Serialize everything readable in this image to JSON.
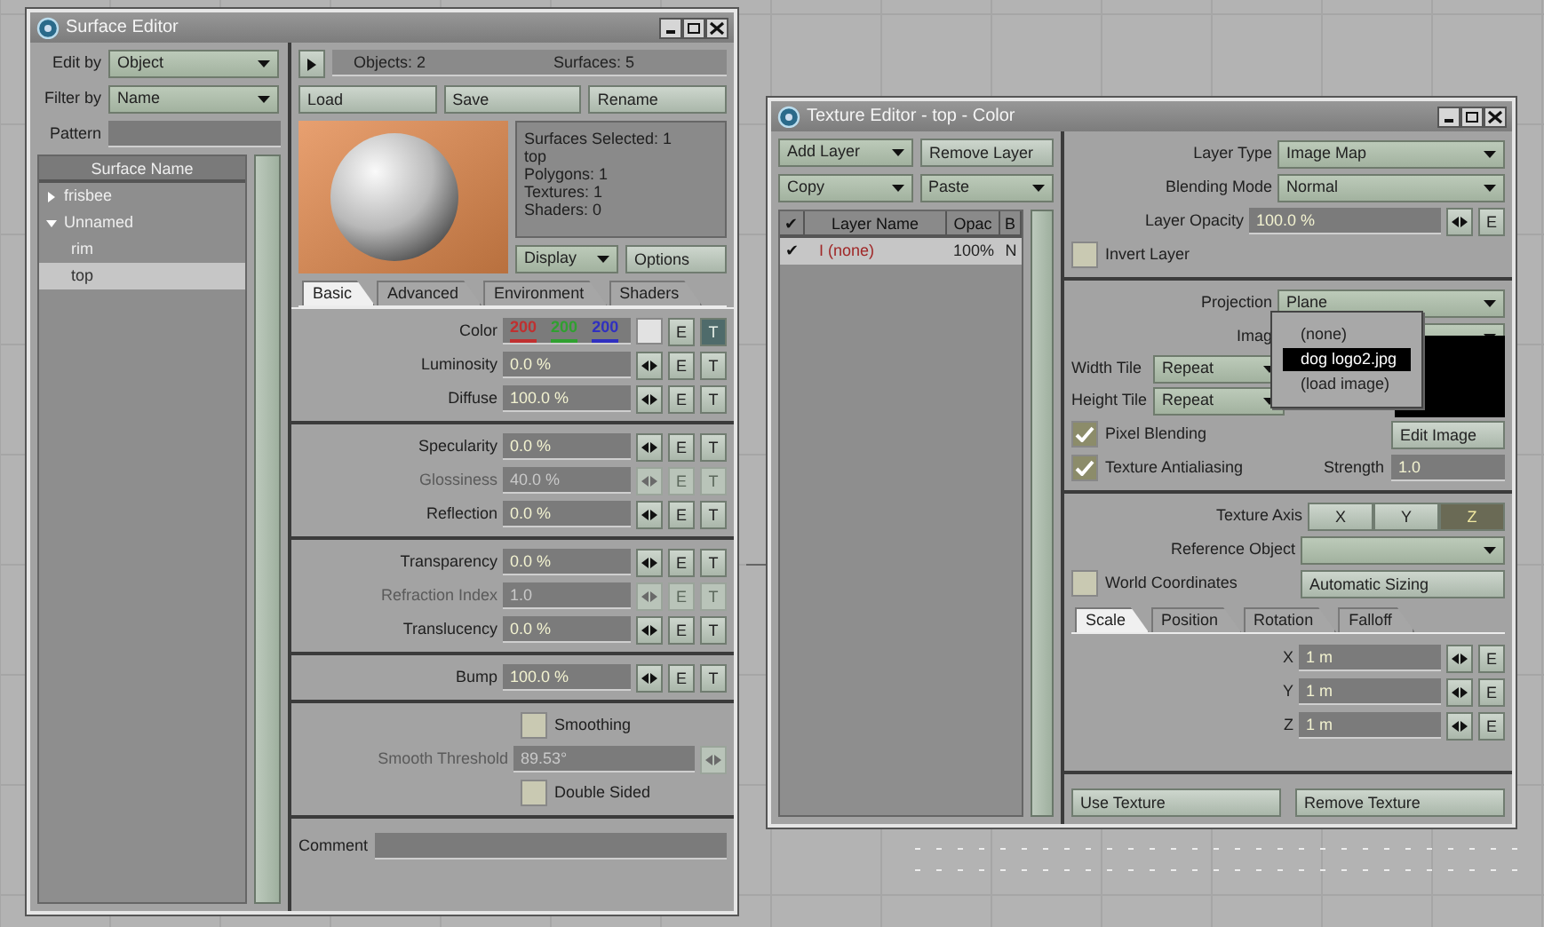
{
  "surface_editor": {
    "title": "Surface Editor",
    "edit_by": {
      "label": "Edit by",
      "value": "Object"
    },
    "filter_by": {
      "label": "Filter by",
      "value": "Name"
    },
    "pattern": {
      "label": "Pattern"
    },
    "list_header": "Surface Name",
    "tree": [
      {
        "label": "frisbee",
        "expanded": false,
        "selected": false
      },
      {
        "label": "Unnamed",
        "expanded": true,
        "selected": false,
        "children": [
          {
            "label": "rim",
            "selected": false
          },
          {
            "label": "top",
            "selected": true
          }
        ]
      }
    ],
    "objects": "Objects: 2",
    "surfaces": "Surfaces: 5",
    "buttons": [
      "Load",
      "Save",
      "Rename"
    ],
    "info": [
      "Surfaces Selected: 1",
      "top",
      "Polygons: 1",
      "Textures: 1",
      "Shaders: 0"
    ],
    "display": "Display",
    "options": "Options",
    "tabs": [
      {
        "label": "Basic",
        "selected": true
      },
      {
        "label": "Advanced",
        "selected": false
      },
      {
        "label": "Environment",
        "selected": false
      },
      {
        "label": "Shaders",
        "selected": false
      }
    ],
    "groups": [
      [
        {
          "kind": "color",
          "label": "Color",
          "values": [
            {
              "text": "200",
              "color": "#c03030"
            },
            {
              "text": "200",
              "color": "#30a030"
            },
            {
              "text": "200",
              "color": "#3030c0"
            }
          ],
          "disabled": false,
          "buttons": [
            {
              "text": "E",
              "on": false
            },
            {
              "text": "T",
              "on": true
            }
          ]
        },
        {
          "kind": "value",
          "label": "Luminosity",
          "value": "0.0 %",
          "disabled": false,
          "buttons": [
            {
              "text": "E",
              "on": false
            },
            {
              "text": "T",
              "on": false
            }
          ]
        },
        {
          "kind": "value",
          "label": "Diffuse",
          "value": "100.0 %",
          "disabled": false,
          "buttons": [
            {
              "text": "E",
              "on": false
            },
            {
              "text": "T",
              "on": false
            }
          ]
        }
      ],
      [
        {
          "kind": "value",
          "label": "Specularity",
          "value": "0.0 %",
          "disabled": false,
          "buttons": [
            {
              "text": "E",
              "on": false
            },
            {
              "text": "T",
              "on": false
            }
          ]
        },
        {
          "kind": "value",
          "label": "Glossiness",
          "value": "40.0 %",
          "disabled": true,
          "buttons": [
            {
              "text": "E",
              "on": false
            },
            {
              "text": "T",
              "on": false
            }
          ]
        },
        {
          "kind": "value",
          "label": "Reflection",
          "value": "0.0 %",
          "disabled": false,
          "buttons": [
            {
              "text": "E",
              "on": false
            },
            {
              "text": "T",
              "on": false
            }
          ]
        }
      ],
      [
        {
          "kind": "value",
          "label": "Transparency",
          "value": "0.0 %",
          "disabled": false,
          "buttons": [
            {
              "text": "E",
              "on": false
            },
            {
              "text": "T",
              "on": false
            }
          ]
        },
        {
          "kind": "value",
          "label": "Refraction Index",
          "value": "1.0",
          "disabled": true,
          "buttons": [
            {
              "text": "E",
              "on": false
            },
            {
              "text": "T",
              "on": false
            }
          ]
        },
        {
          "kind": "value",
          "label": "Translucency",
          "value": "0.0 %",
          "disabled": false,
          "buttons": [
            {
              "text": "E",
              "on": false
            },
            {
              "text": "T",
              "on": false
            }
          ]
        }
      ],
      [
        {
          "kind": "value",
          "label": "Bump",
          "value": "100.0 %",
          "disabled": false,
          "buttons": [
            {
              "text": "E",
              "on": false
            },
            {
              "text": "T",
              "on": false
            }
          ]
        }
      ]
    ],
    "smoothing": {
      "label": "Smoothing",
      "checked": false
    },
    "threshold": {
      "label": "Smooth Threshold",
      "value": "89.53°",
      "disabled": true
    },
    "double_sided": {
      "label": "Double Sided",
      "checked": false
    },
    "comment": {
      "label": "Comment"
    }
  },
  "texture_editor": {
    "title": "Texture Editor - top - Color",
    "add_layer": "Add Layer",
    "remove_layer": "Remove Layer",
    "copy": "Copy",
    "paste": "Paste",
    "columns": [
      "✔",
      "Layer Name",
      "Opac",
      "B"
    ],
    "layers": [
      {
        "check": "✔",
        "name": "I (none)",
        "opacity": "100%",
        "blend": "N",
        "selected": true
      }
    ],
    "layer_type": {
      "label": "Layer Type",
      "value": "Image Map"
    },
    "blending_mode": {
      "label": "Blending Mode",
      "value": "Normal"
    },
    "layer_opacity": {
      "label": "Layer Opacity",
      "value": "100.0 %",
      "buttons": [
        {
          "text": "E",
          "on": false
        }
      ]
    },
    "invert_layer": {
      "label": "Invert Layer",
      "checked": false
    },
    "projection": {
      "label": "Projection",
      "value": "Plane"
    },
    "image": {
      "label": "Imag"
    },
    "image_menu": [
      {
        "label": "(none)",
        "selected": false
      },
      {
        "label": "dog logo2.jpg",
        "selected": true
      },
      {
        "label": "(load image)",
        "selected": false
      }
    ],
    "width_tile": {
      "label": "Width Tile",
      "value": "Repeat"
    },
    "height_tile": {
      "label": "Height Tile",
      "value": "Repeat"
    },
    "pixel_blending": {
      "label": "Pixel Blending",
      "checked": true
    },
    "edit_image": "Edit Image",
    "texture_antialiasing": {
      "label": "Texture Antialiasing",
      "checked": true
    },
    "strength": {
      "label": "Strength",
      "value": "1.0"
    },
    "texture_axis": {
      "label": "Texture Axis",
      "options": [
        {
          "label": "X",
          "selected": false
        },
        {
          "label": "Y",
          "selected": false
        },
        {
          "label": "Z",
          "selected": true
        }
      ]
    },
    "reference_object": {
      "label": "Reference Object"
    },
    "world_coordinates": {
      "label": "World Coordinates",
      "checked": false
    },
    "automatic_sizing": "Automatic Sizing",
    "tabs": [
      {
        "label": "Scale",
        "selected": true
      },
      {
        "label": "Position",
        "selected": false
      },
      {
        "label": "Rotation",
        "selected": false
      },
      {
        "label": "Falloff",
        "selected": false
      }
    ],
    "scale": [
      {
        "label": "X",
        "value": "1 m",
        "buttons": [
          {
            "text": "E",
            "on": false
          }
        ]
      },
      {
        "label": "Y",
        "value": "1 m",
        "buttons": [
          {
            "text": "E",
            "on": false
          }
        ]
      },
      {
        "label": "Z",
        "value": "1 m",
        "buttons": [
          {
            "text": "E",
            "on": false
          }
        ]
      }
    ],
    "use_texture": "Use Texture",
    "remove_texture": "Remove Texture"
  }
}
